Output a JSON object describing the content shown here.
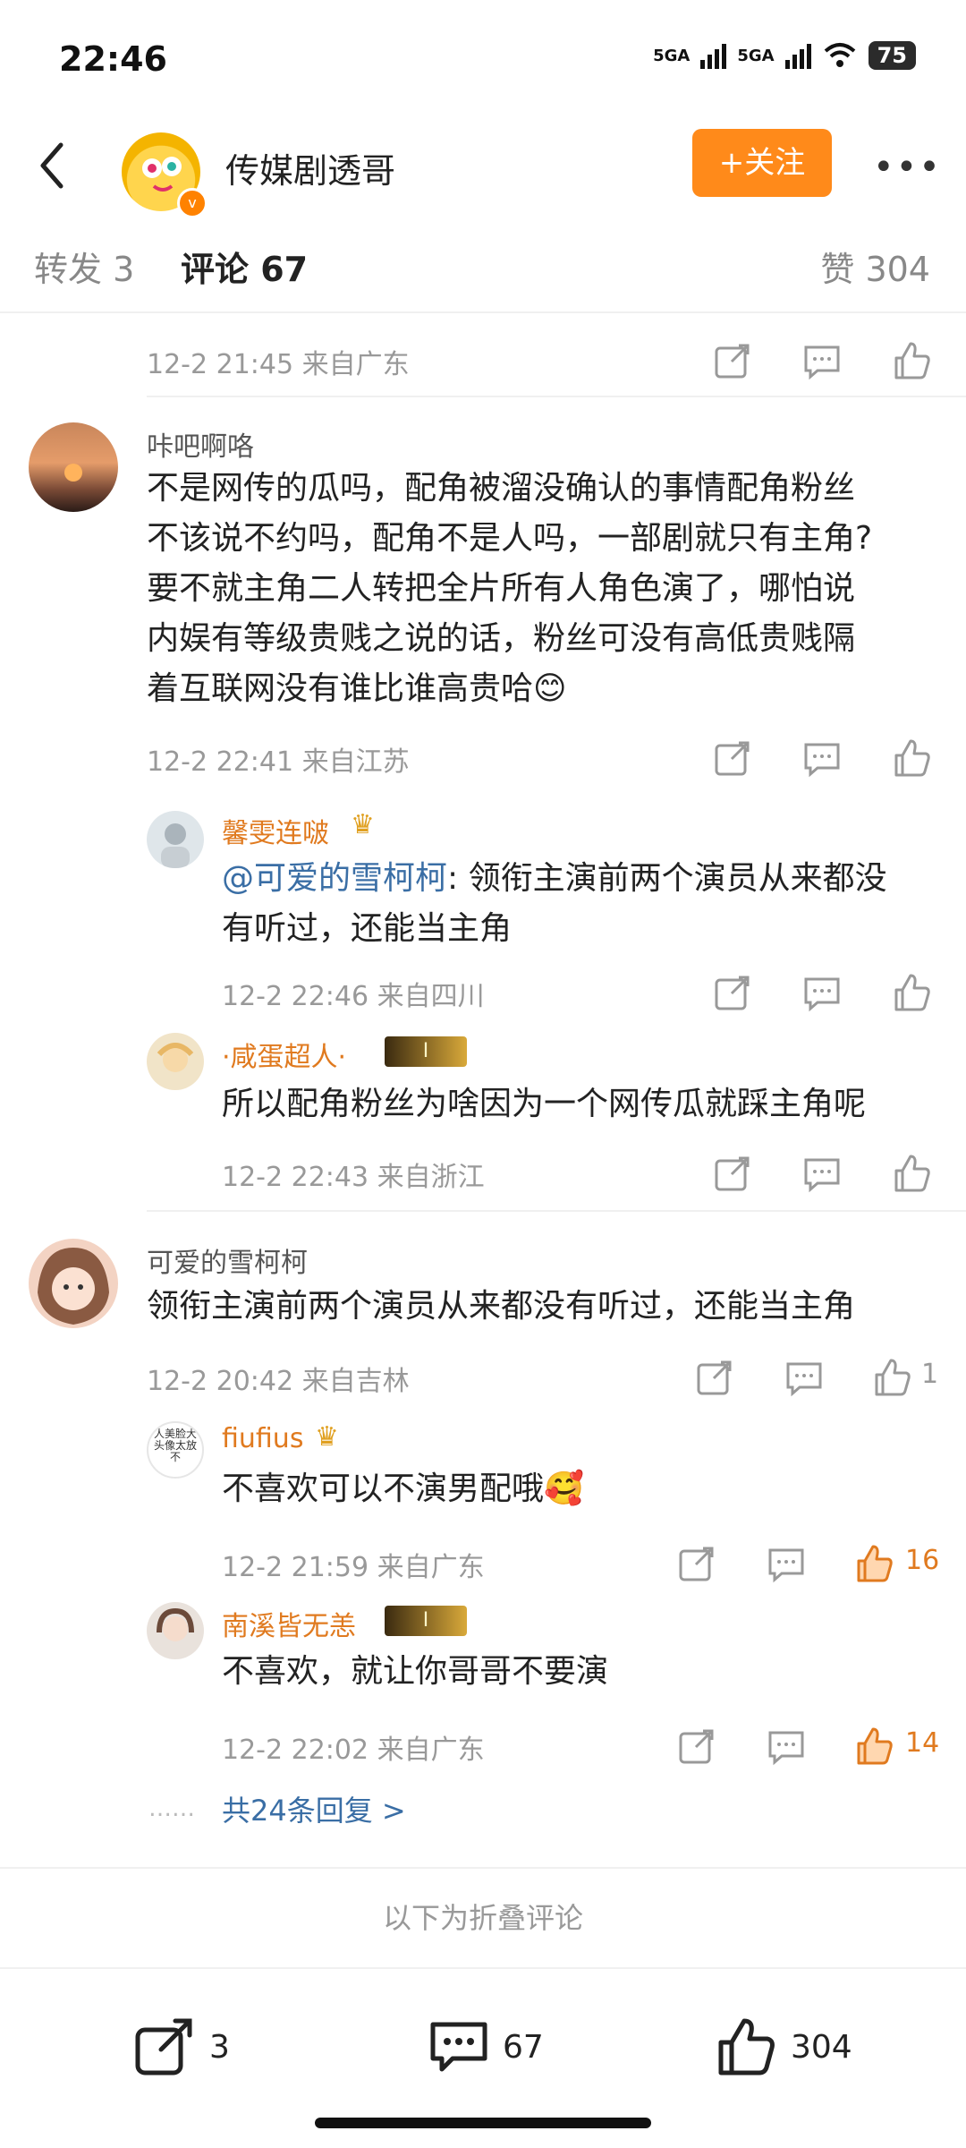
{
  "status_bar": {
    "time": "22:46",
    "net1": "5GA",
    "net2": "5GA",
    "battery": "75"
  },
  "header": {
    "name": "传媒剧透哥",
    "follow_label": "+关注",
    "more_label": "•••"
  },
  "tabs": {
    "repost": "转发 3",
    "comments": "评论 67",
    "likes": "赞 304"
  },
  "top_meta": "12-2 21:45 来自广东",
  "comments": [
    {
      "name": "咔吧啊咯",
      "lines": [
        "不是网传的瓜吗，配角被溜没确认的事情配角粉丝",
        "不该说不约吗，配角不是人吗，一部剧就只有主角?",
        "要不就主角二人转把全片所有人角色演了，哪怕说",
        "内娱有等级贵贱之说的话，粉丝可没有高低贵贱隔",
        "着互联网没有谁比谁高贵哈😊"
      ],
      "meta": "12-2 22:41 来自江苏",
      "replies": [
        {
          "name": "馨雯连啵",
          "mention": "@可爱的雪柯柯",
          "text_line1": ": 领衔主演前两个演员从来都没",
          "text_line2": "有听过，还能当主角",
          "meta": "12-2 22:46 来自四川"
        },
        {
          "name": "·咸蛋超人·",
          "level": "I",
          "text": "所以配角粉丝为啥因为一个网传瓜就踩主角呢",
          "meta": "12-2 22:43 来自浙江"
        }
      ]
    },
    {
      "name": "可爱的雪柯柯",
      "text": "领衔主演前两个演员从来都没有听过，还能当主角",
      "meta": "12-2 20:42 来自吉林",
      "likes": "1",
      "replies": [
        {
          "name": "fiufius",
          "avatar_text": "人美脸大头像太放不",
          "text": "不喜欢可以不演男配哦🥰",
          "meta": "12-2 21:59 来自广东",
          "likes": "16"
        },
        {
          "name": "南溪皆无恙",
          "level": "I",
          "text": "不喜欢，就让你哥哥不要演",
          "meta": "12-2 22:02 来自广东",
          "likes": "14"
        }
      ],
      "more_replies": "共24条回复 >",
      "dots": "……"
    }
  ],
  "fold_text": "以下为折叠评论",
  "bottom_bar": {
    "repost": "3",
    "comments": "67",
    "likes": "304"
  },
  "colors": {
    "accent": "#ff8a1a",
    "reply_name": "#e07a1f",
    "mention": "#3a6ea5"
  }
}
